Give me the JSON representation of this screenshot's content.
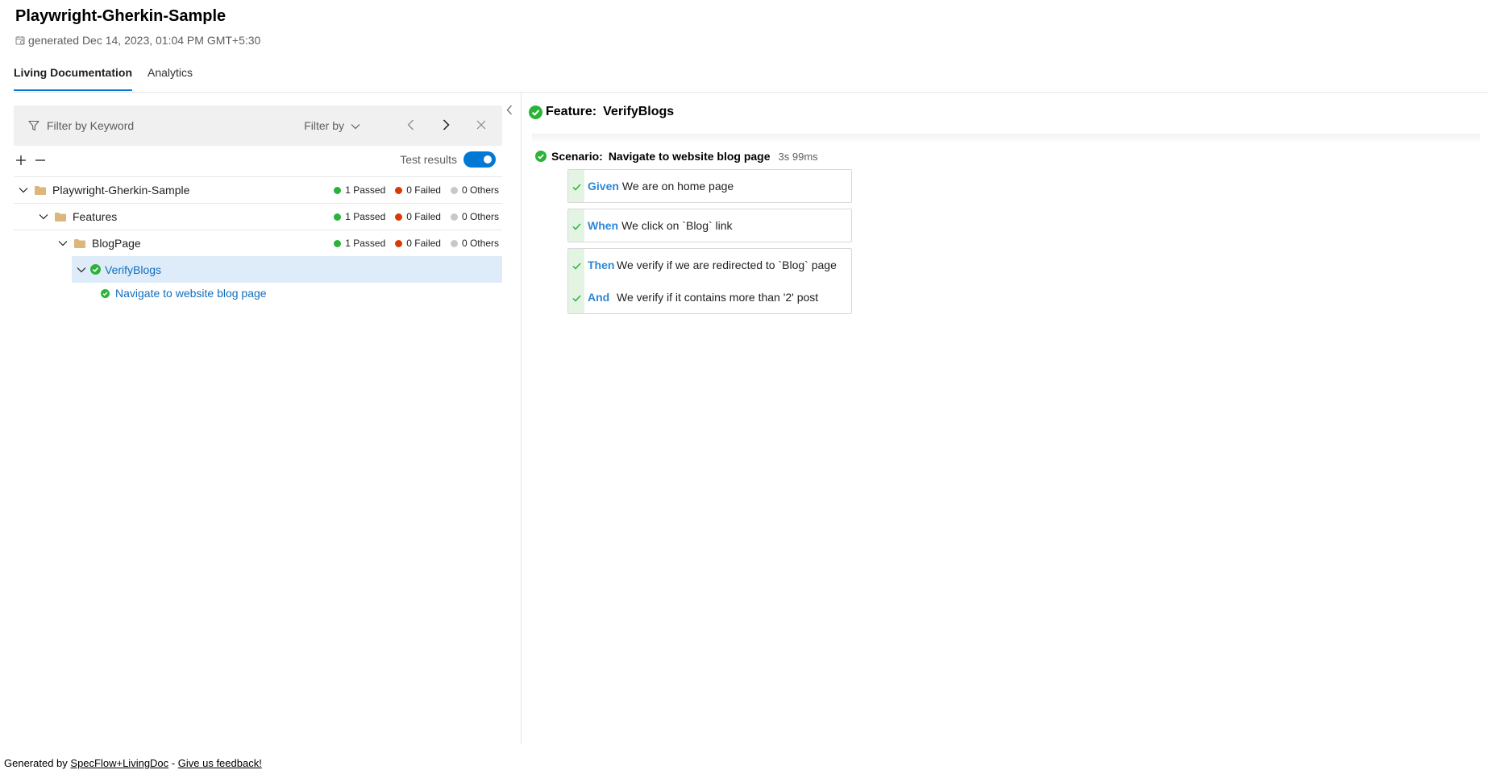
{
  "app": {
    "title": "Playwright-Gherkin-Sample",
    "generated": "generated Dec 14, 2023, 01:04 PM GMT+5:30"
  },
  "tabs": [
    {
      "label": "Living Documentation",
      "active": true
    },
    {
      "label": "Analytics",
      "active": false
    }
  ],
  "filter": {
    "placeholder": "Filter by Keyword",
    "filter_by_label": "Filter by"
  },
  "tree_tools": {
    "test_results_label": "Test results",
    "test_results_on": true
  },
  "tree": {
    "root": {
      "label": "Playwright-Gherkin-Sample",
      "passed": "1 Passed",
      "failed": "0 Failed",
      "others": "0 Others"
    },
    "features": {
      "label": "Features",
      "passed": "1 Passed",
      "failed": "0 Failed",
      "others": "0 Others"
    },
    "blogpage": {
      "label": "BlogPage",
      "passed": "1 Passed",
      "failed": "0 Failed",
      "others": "0 Others"
    },
    "feature_item": {
      "label": "VerifyBlogs"
    },
    "scenario_item": {
      "label": "Navigate to website blog page"
    }
  },
  "detail": {
    "feature_prefix": "Feature:",
    "feature_name": "VerifyBlogs",
    "scenario_prefix": "Scenario:",
    "scenario_name": "Navigate to website blog page",
    "duration": "3s 99ms",
    "steps": [
      {
        "keyword": "Given",
        "text": "We are on home page"
      },
      {
        "keyword": "When",
        "text": "We click on `Blog` link"
      },
      {
        "keyword": "Then",
        "text": "We verify if we are redirected to `Blog` page"
      },
      {
        "keyword": "And",
        "text": "We verify if it contains more than '2' post"
      }
    ]
  },
  "footer": {
    "prefix": "Generated by",
    "link1": "SpecFlow+LivingDoc",
    "separator": "-",
    "link2": "Give us feedback!"
  },
  "colors": {
    "accent": "#0078d4",
    "passed": "#2bb339",
    "failed": "#d83b01",
    "others": "#c8c8c8",
    "selected_row": "#deecf9",
    "step_keyword": "#2b88d8"
  }
}
